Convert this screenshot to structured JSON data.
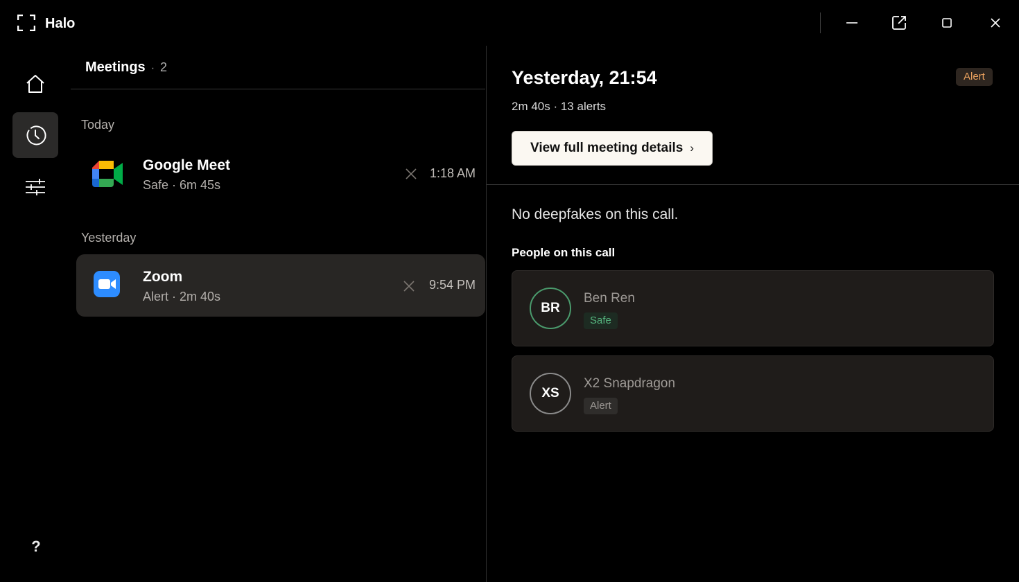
{
  "app": {
    "title": "Halo"
  },
  "window_controls": [
    "minimize-icon",
    "popout-icon",
    "maximize-icon",
    "close-icon"
  ],
  "nav": {
    "items": [
      {
        "name": "home",
        "icon": "home-icon",
        "active": false
      },
      {
        "name": "history",
        "icon": "clock-icon",
        "active": true
      },
      {
        "name": "settings",
        "icon": "sliders-icon",
        "active": false
      }
    ],
    "help_label": "?"
  },
  "meetings": {
    "header": "Meetings",
    "separator": "·",
    "count": "2",
    "sections": [
      {
        "label": "Today",
        "items": [
          {
            "name": "Google Meet",
            "subtitle": "Safe · 6m 45s",
            "time": "1:18 AM",
            "icon": "google-meet-icon",
            "selected": false
          }
        ]
      },
      {
        "label": "Yesterday",
        "items": [
          {
            "name": "Zoom",
            "subtitle": "Alert · 2m 40s",
            "time": "9:54 PM",
            "icon": "zoom-icon",
            "selected": true
          }
        ]
      }
    ]
  },
  "detail": {
    "title": "Yesterday, 21:54",
    "badge": "Alert",
    "meta": "2m 40s · 13 alerts",
    "details_button": "View full meeting details",
    "details_chevron": "›",
    "summary": "No deepfakes on this call.",
    "people_label": "People on this call",
    "people": [
      {
        "initials": "BR",
        "name": "Ben Ren",
        "status": "Safe"
      },
      {
        "initials": "XS",
        "name": "X2 Snapdragon",
        "status": "Alert"
      }
    ]
  },
  "colors": {
    "background": "#000000",
    "selected_row": "#282624",
    "alert_badge_text": "#e9a15e",
    "safe_text": "#56b57f",
    "safe_ring": "#4a9a6c",
    "button_bg": "#fbf8f2"
  }
}
